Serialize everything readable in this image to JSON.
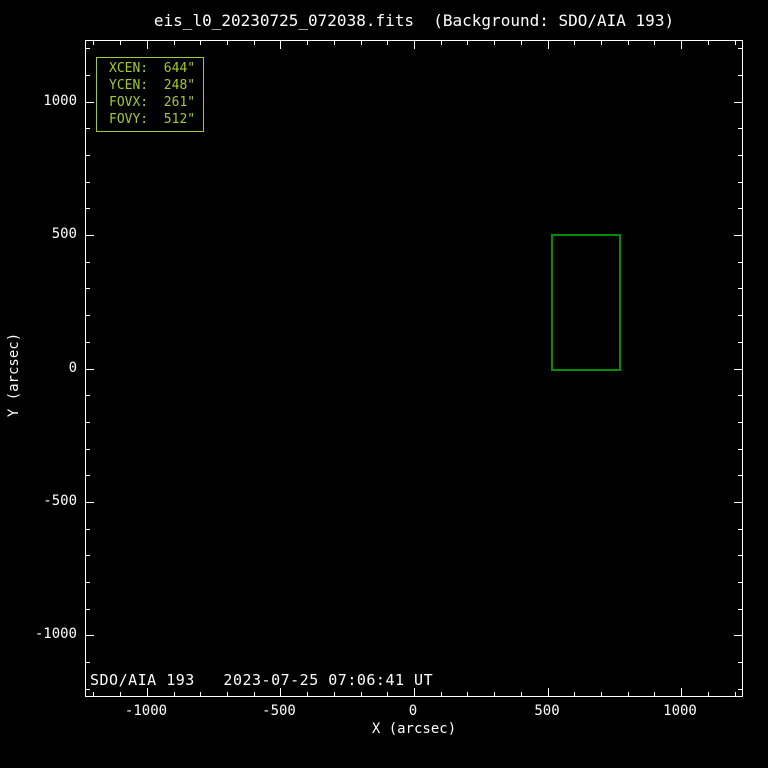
{
  "title": "eis_l0_20230725_072038.fits  (Background: SDO/AIA 193)",
  "background_label": "SDO/AIA 193   2023-07-25 07:06:41 UT",
  "info_box": {
    "lines": [
      "XCEN:  644\"",
      "YCEN:  248\"",
      "FOVX:  261\"",
      "FOVY:  512\""
    ]
  },
  "colors": {
    "background": "#000000",
    "axis": "#ffffff",
    "info_box": "#a2cb2d",
    "fov_box": "#008f00"
  },
  "chart_data": {
    "type": "scatter",
    "title": "eis_l0_20230725_072038.fits  (Background: SDO/AIA 193)",
    "xlabel": "X (arcsec)",
    "ylabel": "Y (arcsec)",
    "xlim": [
      -1228,
      1228
    ],
    "ylim": [
      -1228,
      1228
    ],
    "x_major_ticks": [
      -1000,
      -500,
      0,
      500,
      1000
    ],
    "x_tick_labels": [
      "-1000",
      "-500",
      "0",
      "500",
      "1000"
    ],
    "y_major_ticks": [
      -1000,
      -500,
      0,
      500,
      1000
    ],
    "y_tick_labels": [
      "-1000",
      "-500",
      "0",
      "500",
      "1000"
    ],
    "minor_tick_interval": 100,
    "grid": false,
    "legend": null,
    "series": [],
    "fov_rectangle": {
      "xcen_arcsec": 644,
      "ycen_arcsec": 248,
      "fovx_arcsec": 261,
      "fovy_arcsec": 512,
      "x_range": [
        513.5,
        774.5
      ],
      "y_range": [
        -8,
        504
      ]
    },
    "annotations": [
      "XCEN:  644\"",
      "YCEN:  248\"",
      "FOVX:  261\"",
      "FOVY:  512\"",
      "SDO/AIA 193   2023-07-25 07:06:41 UT"
    ]
  }
}
